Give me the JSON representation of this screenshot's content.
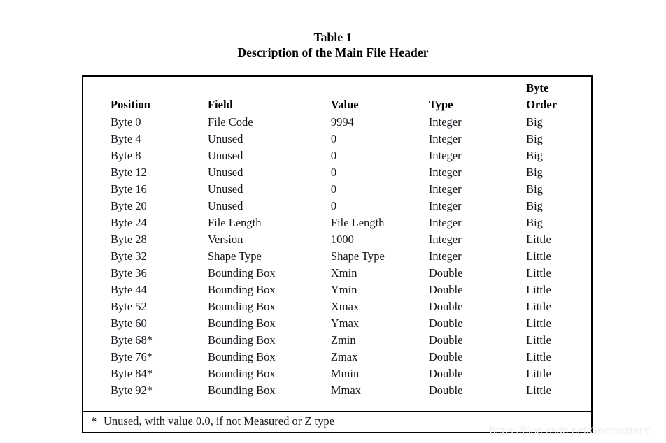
{
  "document": {
    "title_line_1": "Table 1",
    "title_line_2": "Description of the Main File Header"
  },
  "table": {
    "columns": [
      {
        "key": "position",
        "label_top": "",
        "label": "Position"
      },
      {
        "key": "field",
        "label_top": "",
        "label": "Field"
      },
      {
        "key": "value",
        "label_top": "",
        "label": "Value"
      },
      {
        "key": "type",
        "label_top": "",
        "label": "Type"
      },
      {
        "key": "byte_order",
        "label_top": "Byte",
        "label": "Order"
      }
    ],
    "rows": [
      {
        "position": "Byte 0",
        "field": "File Code",
        "value": "9994",
        "type": "Integer",
        "byte_order": "Big"
      },
      {
        "position": "Byte 4",
        "field": "Unused",
        "value": "0",
        "type": "Integer",
        "byte_order": "Big"
      },
      {
        "position": "Byte 8",
        "field": "Unused",
        "value": "0",
        "type": "Integer",
        "byte_order": "Big"
      },
      {
        "position": "Byte 12",
        "field": "Unused",
        "value": "0",
        "type": "Integer",
        "byte_order": "Big"
      },
      {
        "position": "Byte 16",
        "field": "Unused",
        "value": "0",
        "type": "Integer",
        "byte_order": "Big"
      },
      {
        "position": "Byte 20",
        "field": "Unused",
        "value": "0",
        "type": "Integer",
        "byte_order": "Big"
      },
      {
        "position": "Byte 24",
        "field": "File Length",
        "value": "File Length",
        "type": "Integer",
        "byte_order": "Big"
      },
      {
        "position": "Byte 28",
        "field": "Version",
        "value": "1000",
        "type": "Integer",
        "byte_order": "Little"
      },
      {
        "position": "Byte 32",
        "field": "Shape Type",
        "value": "Shape Type",
        "type": "Integer",
        "byte_order": "Little"
      },
      {
        "position": "Byte 36",
        "field": "Bounding Box",
        "value": "Xmin",
        "type": "Double",
        "byte_order": "Little"
      },
      {
        "position": "Byte 44",
        "field": "Bounding Box",
        "value": "Ymin",
        "type": "Double",
        "byte_order": "Little"
      },
      {
        "position": "Byte 52",
        "field": "Bounding Box",
        "value": "Xmax",
        "type": "Double",
        "byte_order": "Little"
      },
      {
        "position": "Byte 60",
        "field": "Bounding Box",
        "value": "Ymax",
        "type": "Double",
        "byte_order": "Little"
      },
      {
        "position": "Byte 68*",
        "field": "Bounding Box",
        "value": "Zmin",
        "type": "Double",
        "byte_order": "Little"
      },
      {
        "position": "Byte 76*",
        "field": "Bounding Box",
        "value": "Zmax",
        "type": "Double",
        "byte_order": "Little"
      },
      {
        "position": "Byte 84*",
        "field": "Bounding Box",
        "value": "Mmin",
        "type": "Double",
        "byte_order": "Little"
      },
      {
        "position": "Byte 92*",
        "field": "Bounding Box",
        "value": "Mmax",
        "type": "Double",
        "byte_order": "Little"
      }
    ],
    "footnote": {
      "marker": "*",
      "text": "Unused, with value 0.0, if not Measured or Z type"
    }
  },
  "watermark": {
    "text": "https://blog.csdn.net/GeomasterYi"
  },
  "colors": {
    "page_background": "#ffffff",
    "text": "#15161c",
    "border": "#000000",
    "watermark": "#eceef0"
  }
}
